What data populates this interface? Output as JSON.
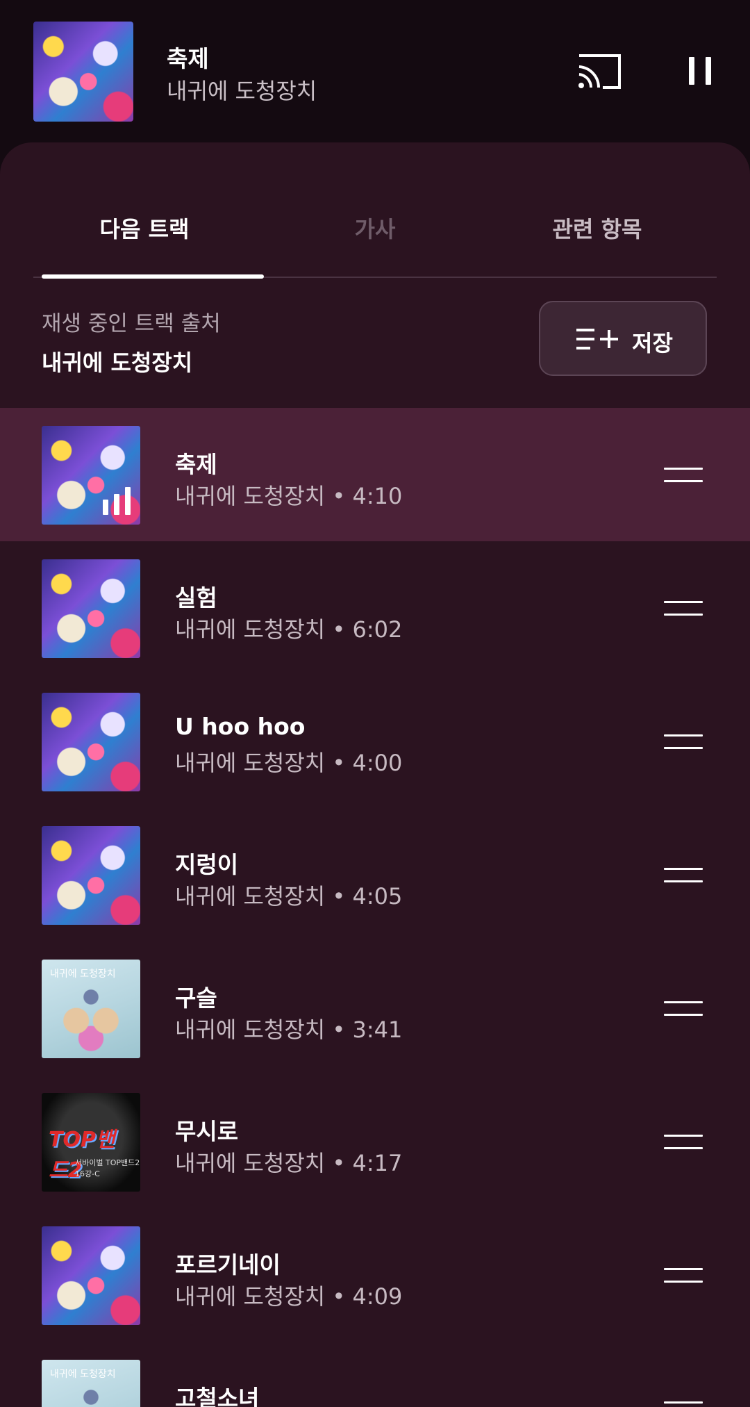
{
  "mini_player": {
    "title": "축제",
    "artist": "내귀에 도청장치",
    "cast_icon": "cast-icon",
    "pause_icon": "pause-icon"
  },
  "tabs": [
    {
      "label": "다음 트랙",
      "active": true
    },
    {
      "label": "가사",
      "active": false
    },
    {
      "label": "관련 항목",
      "active": false
    }
  ],
  "source": {
    "label": "재생 중인 트랙 출처",
    "value": "내귀에 도청장치"
  },
  "save_button": {
    "label": "저장",
    "icon": "playlist-add-icon"
  },
  "queue": [
    {
      "title": "축제",
      "subtitle": "내귀에 도청장치 • 4:10",
      "art": "a",
      "playing": true
    },
    {
      "title": "실험",
      "subtitle": "내귀에 도청장치 • 6:02",
      "art": "a"
    },
    {
      "title": "U hoo hoo",
      "subtitle": "내귀에 도청장치 • 4:00",
      "art": "a"
    },
    {
      "title": "지렁이",
      "subtitle": "내귀에 도청장치 • 4:05",
      "art": "a"
    },
    {
      "title": "구슬",
      "subtitle": "내귀에 도청장치 • 3:41",
      "art": "b"
    },
    {
      "title": "무시로",
      "subtitle": "내귀에 도청장치 • 4:17",
      "art": "c"
    },
    {
      "title": "포르기네이",
      "subtitle": "내귀에 도청장치 • 4:09",
      "art": "a"
    },
    {
      "title": "고철소녀",
      "subtitle": "",
      "art": "b"
    }
  ],
  "art_text": {
    "top_band_logo": "TOP밴드2",
    "top_band_caption": "서바이벌 TOP밴드2 16강-C",
    "album_b_text": "내귀에 도청장치"
  },
  "colors": {
    "background": "#140a11",
    "sheet": "#2b1320",
    "active_row": "#4b2137"
  }
}
